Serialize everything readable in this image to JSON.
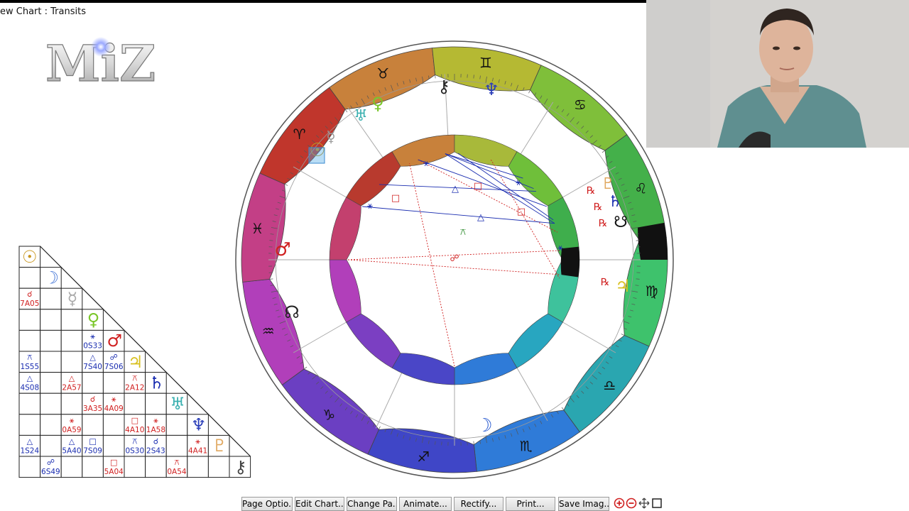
{
  "window": {
    "title": "ew Chart : Transits"
  },
  "logo": {
    "text": "MiZ"
  },
  "wheel": {
    "signs": [
      "♈",
      "♉",
      "♊",
      "♋",
      "♌",
      "♍",
      "♎",
      "♏",
      "♐",
      "♑",
      "♒",
      "♓"
    ],
    "planet_glyphs": {
      "sun": "☉",
      "mercury": "☿",
      "venus": "♀",
      "uranus": "♅",
      "chiron": "⚷",
      "neptune": "♆",
      "pluto": "♇",
      "saturn": "♄",
      "node_south": "☋",
      "jupiter": "♃",
      "mars": "♂",
      "node_north": "☊",
      "moon": "☽"
    },
    "retrograde": "℞",
    "inner_symbols": {
      "trine": "△",
      "square": "□",
      "sextile": "⚹",
      "opposition": "☍",
      "semisextile": "⚻"
    }
  },
  "aspect_grid": {
    "column_glyphs": [
      "☉",
      "☽",
      "☿",
      "♀",
      "♂",
      "♃",
      "♄",
      "♅",
      "♆",
      "♇",
      "⚷"
    ],
    "cells": [
      {
        "row": 2,
        "col": 0,
        "symbol": "☌",
        "label": "7A05",
        "color": "#d02020"
      },
      {
        "row": 4,
        "col": 3,
        "symbol": "⚹",
        "label": "0S33",
        "color": "#1a2db0"
      },
      {
        "row": 5,
        "col": 0,
        "symbol": "⚻",
        "label": "1S55",
        "color": "#1a2db0"
      },
      {
        "row": 5,
        "col": 3,
        "symbol": "△",
        "label": "7S40",
        "color": "#1a2db0"
      },
      {
        "row": 5,
        "col": 4,
        "symbol": "☍",
        "label": "7S06",
        "color": "#1a2db0"
      },
      {
        "row": 6,
        "col": 0,
        "symbol": "△",
        "label": "4S08",
        "color": "#1a2db0"
      },
      {
        "row": 6,
        "col": 2,
        "symbol": "△",
        "label": "2A57",
        "color": "#d02020"
      },
      {
        "row": 6,
        "col": 5,
        "symbol": "⚻",
        "label": "2A12",
        "color": "#d02020"
      },
      {
        "row": 7,
        "col": 3,
        "symbol": "☌",
        "label": "3A35",
        "color": "#d02020"
      },
      {
        "row": 7,
        "col": 4,
        "symbol": "⚹",
        "label": "4A09",
        "color": "#d02020"
      },
      {
        "row": 8,
        "col": 2,
        "symbol": "⚹",
        "label": "0A59",
        "color": "#d02020"
      },
      {
        "row": 8,
        "col": 5,
        "symbol": "□",
        "label": "4A10",
        "color": "#d02020"
      },
      {
        "row": 8,
        "col": 6,
        "symbol": "⚹",
        "label": "1A58",
        "color": "#d02020"
      },
      {
        "row": 9,
        "col": 0,
        "symbol": "△",
        "label": "1S24",
        "color": "#1a2db0"
      },
      {
        "row": 9,
        "col": 2,
        "symbol": "△",
        "label": "5A40",
        "color": "#1a2db0"
      },
      {
        "row": 9,
        "col": 3,
        "symbol": "□",
        "label": "7S09",
        "color": "#1a2db0"
      },
      {
        "row": 9,
        "col": 5,
        "symbol": "⚻",
        "label": "0S30",
        "color": "#1a2db0"
      },
      {
        "row": 9,
        "col": 6,
        "symbol": "☌",
        "label": "2S43",
        "color": "#1a2db0"
      },
      {
        "row": 9,
        "col": 8,
        "symbol": "⚹",
        "label": "4A41",
        "color": "#d02020"
      },
      {
        "row": 10,
        "col": 1,
        "symbol": "☍",
        "label": "6S49",
        "color": "#1a2db0"
      },
      {
        "row": 10,
        "col": 4,
        "symbol": "□",
        "label": "5A04",
        "color": "#d02020"
      },
      {
        "row": 10,
        "col": 7,
        "symbol": "⚻",
        "label": "0A54",
        "color": "#d02020"
      }
    ]
  },
  "toolbar": {
    "page_options": "Page Optio...",
    "edit_chart": "Edit Chart...",
    "change_pages": "Change Pa...",
    "animate": "Animate...",
    "rectify": "Rectify...",
    "print": "Print...",
    "save_image": "Save Imag..."
  },
  "colors": {
    "aspect_blue": "#1a2db0",
    "aspect_red": "#d02020"
  }
}
